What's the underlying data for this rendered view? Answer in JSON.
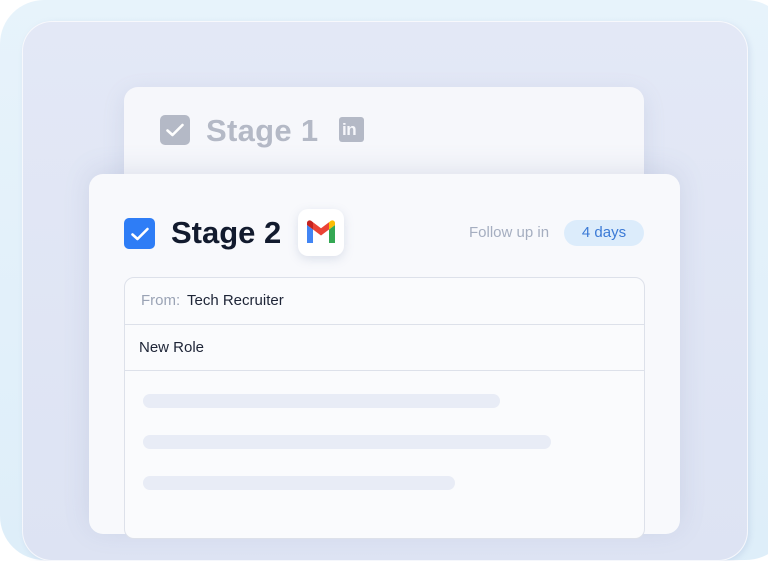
{
  "stages": {
    "previous": {
      "title": "Stage 1",
      "checked": true,
      "channel_icon": "linkedin-icon",
      "channel_icon_text": "in"
    },
    "current": {
      "title": "Stage 2",
      "checked": true,
      "channel_icon": "gmail-icon",
      "follow_up_label": "Follow up in",
      "follow_up_value": "4 days"
    }
  },
  "email": {
    "from_label": "From:",
    "from_value": "Tech Recruiter",
    "subject": "New Role",
    "body_placeholder_lines": 3
  },
  "colors": {
    "accent_blue": "#2e7df6",
    "badge_bg": "#dcecfb",
    "badge_text": "#3b7ad6",
    "muted_gray": "#b4b9c6",
    "title_dark": "#121b2e"
  }
}
